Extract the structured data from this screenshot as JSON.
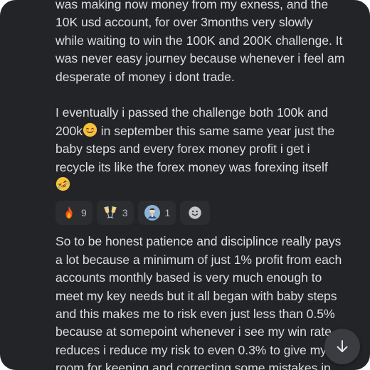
{
  "message": {
    "para1_lines": [
      "was making now money from my exness, and the",
      "10K usd account, for over 3months very slowly",
      "while waiting to win the 100K and 200K challenge. It",
      "was never easy journey because whenever i feel am",
      "desperate of money i dont trade."
    ],
    "para2_line1": "I eventually i passed the challenge both 100k and",
    "para2_line2_a": "200k",
    "para2_line2_b": " in september this same same year just the",
    "para2_lines_rest": [
      "baby steps and every forex money profit i get i",
      "recycle its like the forex money was forexing itself"
    ],
    "para3_lines": [
      "So to be honest patience and disciplince really pays",
      "a lot because a minimum of just 1% profit from each",
      "accounts monthly based is very much enough to",
      "meet my key needs but it all began with baby steps",
      "and this makes me to risk even just less than 0.5%",
      "because at somepoint whenever i see my win rate",
      "reduces i reduce my risk to even 0.3% to give my self",
      "room for keeping and correcting some mistakes in"
    ]
  },
  "reactions": [
    {
      "icon": "fire-icon",
      "count": "9"
    },
    {
      "icon": "clinking-glasses-icon",
      "count": "3"
    },
    {
      "icon": "custom-avatar-emoji-icon",
      "count": "1"
    }
  ],
  "colors": {
    "background": "#232428",
    "text": "#dcdee1",
    "reaction_bg": "#2b2d31",
    "count_text": "#b5bac1"
  }
}
